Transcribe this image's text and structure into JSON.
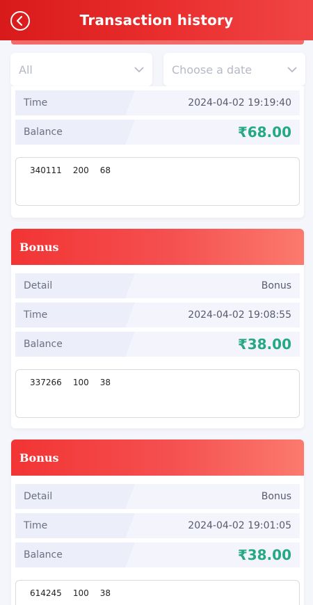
{
  "header": {
    "title": "Transaction history",
    "back_icon": "back-circle-icon"
  },
  "filters": {
    "type": {
      "value": "All"
    },
    "date": {
      "placeholder": "Choose a date"
    }
  },
  "colors": {
    "header": "#e02424",
    "accent": "#25a883",
    "card_head": "#f23434"
  },
  "transactions": [
    {
      "title": "",
      "detail": "",
      "time_label": "Time",
      "time": "2024-04-02 19:19:40",
      "balance_label": "Balance",
      "balance": "₹68.00",
      "note": [
        "340111",
        "200",
        "68"
      ]
    },
    {
      "title": "Bonus",
      "detail_label": "Detail",
      "detail": "Bonus",
      "time_label": "Time",
      "time": "2024-04-02 19:08:55",
      "balance_label": "Balance",
      "balance": "₹38.00",
      "note": [
        "337266",
        "100",
        "38"
      ]
    },
    {
      "title": "Bonus",
      "detail_label": "Detail",
      "detail": "Bonus",
      "time_label": "Time",
      "time": "2024-04-02 19:01:05",
      "balance_label": "Balance",
      "balance": "₹38.00",
      "note": [
        "614245",
        "100",
        "38"
      ]
    }
  ]
}
